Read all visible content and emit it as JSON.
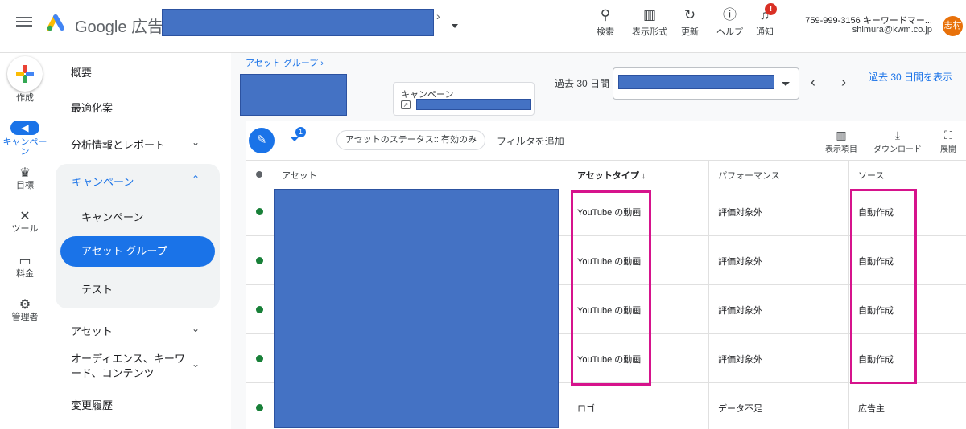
{
  "topbar": {
    "brand": "Google 広告",
    "tools": [
      {
        "label": "検索",
        "icon": "search-icon",
        "glyph": "⚲"
      },
      {
        "label": "表示形式",
        "icon": "appearance-icon",
        "glyph": "▥"
      },
      {
        "label": "更新",
        "icon": "refresh-icon",
        "glyph": "↻"
      },
      {
        "label": "ヘルプ",
        "icon": "help-icon",
        "glyph": "?"
      },
      {
        "label": "通知",
        "icon": "bell-icon",
        "glyph": "🔔"
      }
    ],
    "notification_badge": "!",
    "account_id": "759-999-3156 キーワードマー...",
    "account_email": "shimura@kwm.co.jp",
    "avatar_text": "志村"
  },
  "rail": {
    "create": "作成",
    "items": [
      {
        "label": "キャンペーン",
        "icon": "campaign-icon",
        "glyph": "📢"
      },
      {
        "label": "目標",
        "icon": "trophy-icon",
        "glyph": "🏆"
      },
      {
        "label": "ツール",
        "icon": "tools-icon",
        "glyph": "⚒"
      },
      {
        "label": "料金",
        "icon": "billing-icon",
        "glyph": "▭"
      },
      {
        "label": "管理者",
        "icon": "admin-gear-icon",
        "glyph": "⚙"
      }
    ]
  },
  "sidenav": {
    "overview": "概要",
    "recommendations": "最適化案",
    "insights": "分析情報とレポート",
    "campaigns_group": "キャンペーン",
    "campaigns": "キャンペーン",
    "asset_groups": "アセット グループ",
    "experiments": "テスト",
    "assets": "アセット",
    "audiences": "オーディエンス、キーワード、コンテンツ",
    "change_history": "変更履歴"
  },
  "main": {
    "breadcrumb": "アセット グループ ›",
    "campaign_chip_label": "キャンペーン",
    "period_label": "過去 30 日間",
    "period_link": "過去 30 日間を表示",
    "filter_count": "1",
    "status_filter": "アセットのステータス:: 有効のみ",
    "add_filter": "フィルタを追加",
    "table_tools": [
      {
        "label": "表示項目",
        "icon": "columns-icon",
        "glyph": "▥"
      },
      {
        "label": "ダウンロード",
        "icon": "download-icon",
        "glyph": "⤓"
      },
      {
        "label": "展開",
        "icon": "expand-icon",
        "glyph": "⛶"
      }
    ],
    "columns": {
      "asset": "アセット",
      "asset_type": "アセットタイプ ↓",
      "performance": "パフォーマンス",
      "source": "ソース"
    },
    "rows": [
      {
        "type": "YouTube の動画",
        "performance": "評価対象外",
        "source": "自動作成"
      },
      {
        "type": "YouTube の動画",
        "performance": "評価対象外",
        "source": "自動作成"
      },
      {
        "type": "YouTube の動画",
        "performance": "評価対象外",
        "source": "自動作成"
      },
      {
        "type": "YouTube の動画",
        "performance": "評価対象外",
        "source": "自動作成"
      },
      {
        "type": "ロゴ",
        "performance": "データ不足",
        "source": "広告主"
      }
    ]
  },
  "colors": {
    "accent": "#1a73e8",
    "redaction": "#4472c4",
    "highlight": "#d6138c",
    "status_green": "#188038"
  }
}
